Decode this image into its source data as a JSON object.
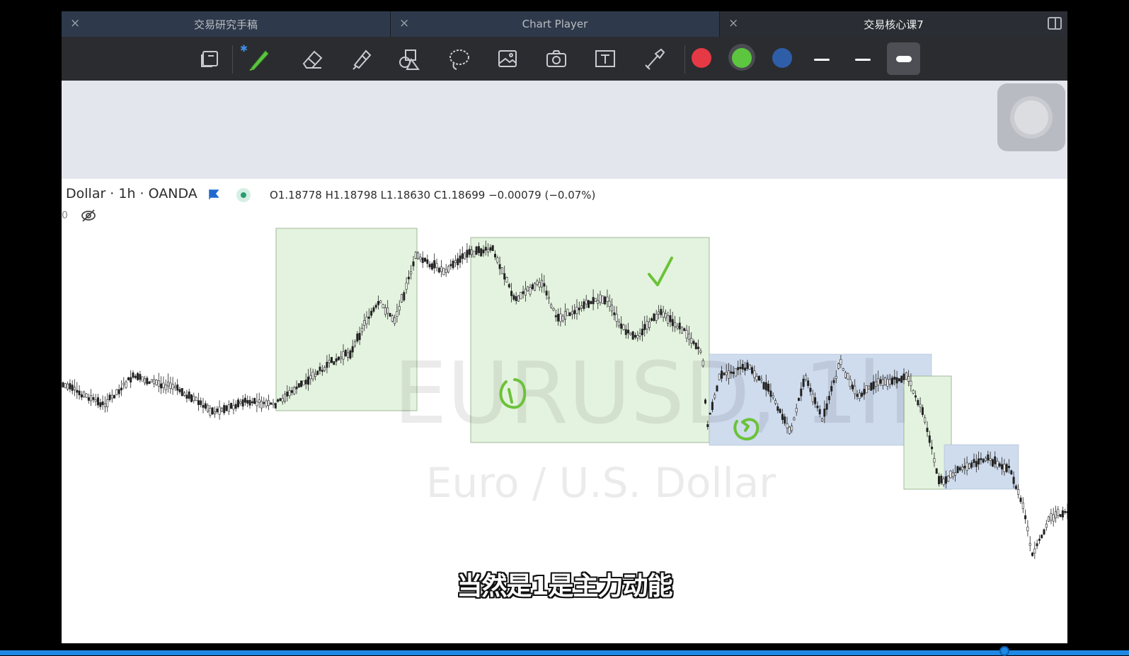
{
  "tabs": [
    {
      "label": "交易研究手稿",
      "close": "×",
      "active": false
    },
    {
      "label": "Chart Player",
      "close": "×",
      "active": false
    },
    {
      "label": "交易核心课7",
      "close": "×",
      "active": true
    }
  ],
  "toolbar": {
    "tools": [
      "page-layout-icon",
      "pen-icon",
      "eraser-icon",
      "highlighter-icon",
      "shapes-icon",
      "lasso-icon",
      "image-icon",
      "camera-icon",
      "text-box-icon",
      "laser-pointer-icon"
    ],
    "colors": [
      "#e63946",
      "#5cc63f",
      "#2f5ea8"
    ],
    "selected_color": "#5cc63f",
    "bluetooth_glyph": "✱"
  },
  "chart": {
    "symbol_label": "Dollar · 1h · OANDA",
    "ohlc": "O1.18778  H1.18798  L1.18630  C1.18699  −0.00079 (−0.07%)",
    "scale_fragment": "0",
    "watermark_symbol": "EURUSD, 1h",
    "watermark_name": "Euro / U.S. Dollar",
    "zone_colors": {
      "green": "#e4f3df",
      "blue": "#cfdcee"
    },
    "annotation_color": "#6cc23a"
  },
  "subtitle": "当然是1是主力动能"
}
